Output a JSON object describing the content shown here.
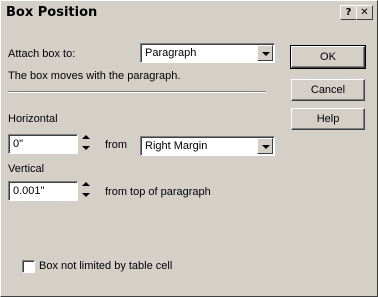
{
  "window": {
    "title": "Box Position",
    "help_glyph": "?",
    "close_glyph": "✕"
  },
  "attach": {
    "label": "Attach box to:",
    "selected": "Paragraph",
    "description": "The box moves with the paragraph."
  },
  "horizontal": {
    "label": "Horizontal",
    "value": "0\"",
    "from_label": "from",
    "from_selected": "Right Margin"
  },
  "vertical": {
    "label": "Vertical",
    "value": "0.001\"",
    "from_label": "from top of paragraph"
  },
  "checkbox": {
    "label": "Box not limited by table cell",
    "checked": false
  },
  "buttons": {
    "ok": "OK",
    "cancel": "Cancel",
    "help": "Help"
  }
}
